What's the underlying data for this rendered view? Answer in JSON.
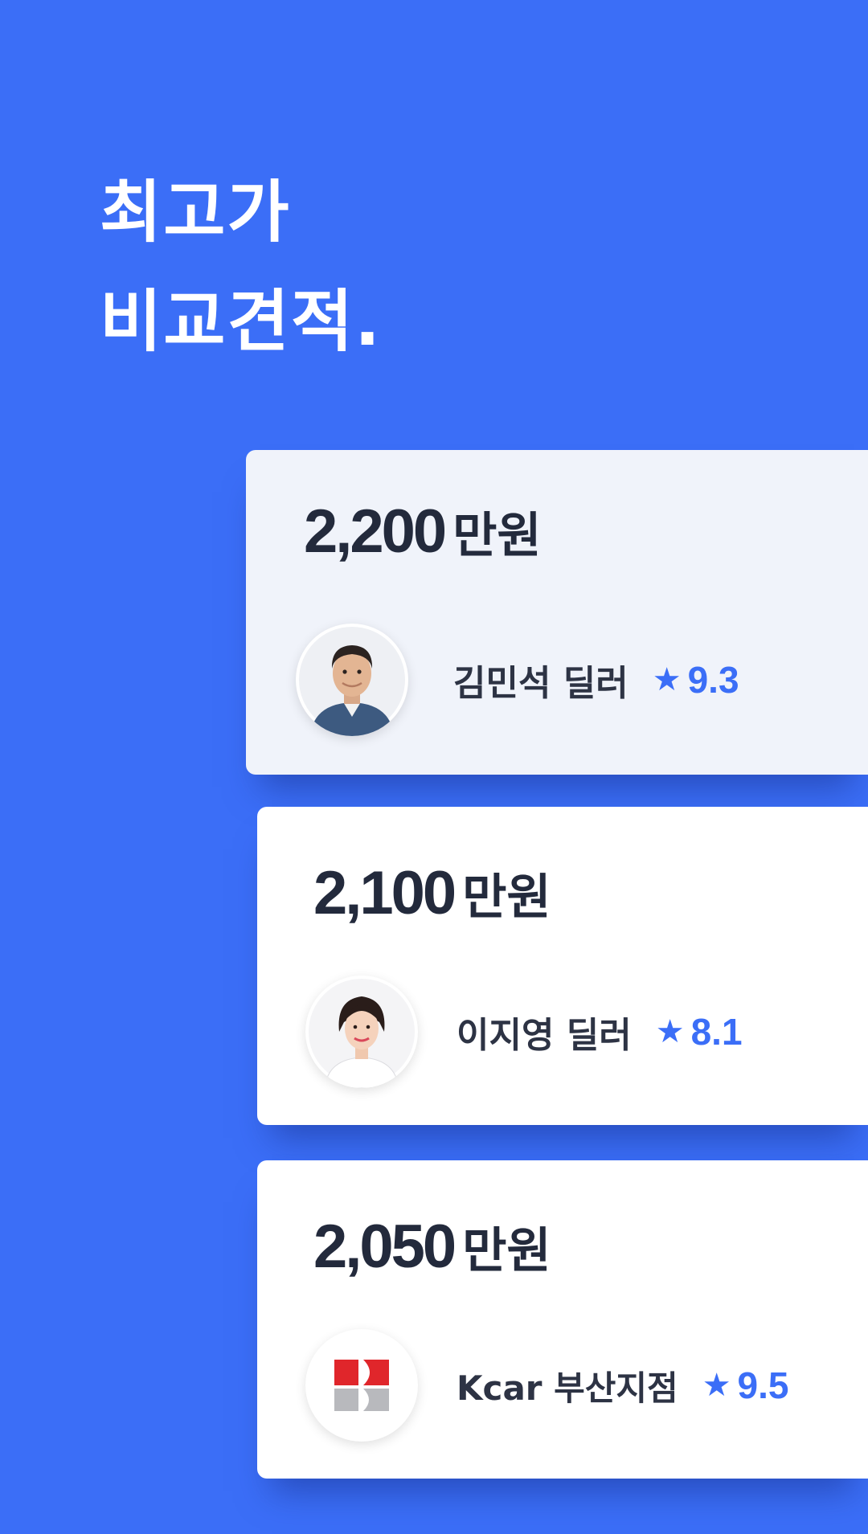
{
  "headline": {
    "line1": "최고가",
    "line2": "비교견적."
  },
  "cards": [
    {
      "amount": "2,200",
      "unit": "만원",
      "dealer_name": "김민석 딜러",
      "rating": "9.3",
      "avatar": "male-dealer-photo",
      "highlighted": true
    },
    {
      "amount": "2,100",
      "unit": "만원",
      "dealer_name": "이지영 딜러",
      "rating": "8.1",
      "avatar": "female-dealer-photo",
      "highlighted": false
    },
    {
      "amount": "2,050",
      "unit": "만원",
      "dealer_name": "Kcar 부산지점",
      "rating": "9.5",
      "avatar": "kcar-logo",
      "highlighted": false
    }
  ],
  "icons": {
    "star": "star-icon"
  },
  "colors": {
    "background": "#3b6ef7",
    "accent": "#3b6ef7",
    "text_dark": "#232a3c",
    "card_highlight": "#f0f3fa",
    "kcar_red": "#e0262b",
    "kcar_gray": "#b8b9bd"
  }
}
